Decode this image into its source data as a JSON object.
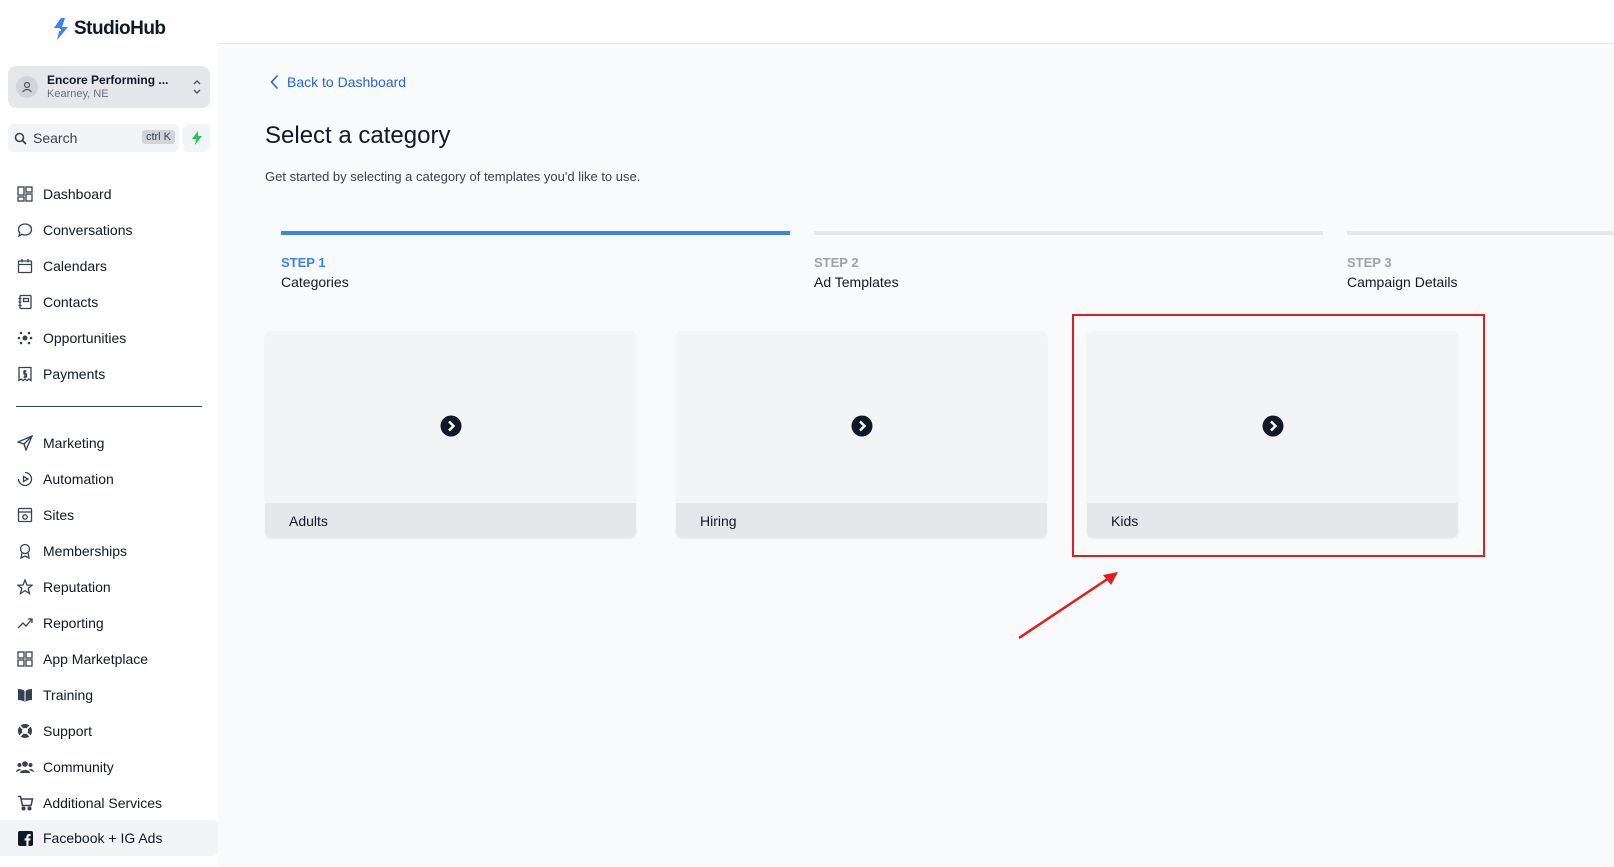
{
  "brand": {
    "name": "StudioHub",
    "accent": "#3b82f6"
  },
  "account": {
    "name": "Encore Performing ...",
    "location": "Kearney, NE"
  },
  "search": {
    "label": "Search",
    "shortcut": "ctrl K"
  },
  "sidebar": {
    "items": [
      {
        "label": "Dashboard",
        "icon": "dashboard-icon"
      },
      {
        "label": "Conversations",
        "icon": "chat-icon"
      },
      {
        "label": "Calendars",
        "icon": "calendar-icon"
      },
      {
        "label": "Contacts",
        "icon": "contacts-icon"
      },
      {
        "label": "Opportunities",
        "icon": "opportunities-icon"
      },
      {
        "label": "Payments",
        "icon": "payments-icon"
      }
    ],
    "items2": [
      {
        "label": "Marketing",
        "icon": "send-icon"
      },
      {
        "label": "Automation",
        "icon": "automation-icon"
      },
      {
        "label": "Sites",
        "icon": "sites-icon"
      },
      {
        "label": "Memberships",
        "icon": "award-icon"
      },
      {
        "label": "Reputation",
        "icon": "star-icon"
      },
      {
        "label": "Reporting",
        "icon": "trend-icon"
      },
      {
        "label": "App Marketplace",
        "icon": "grid-icon"
      },
      {
        "label": "Training",
        "icon": "book-icon"
      },
      {
        "label": "Support",
        "icon": "lifebuoy-icon"
      },
      {
        "label": "Community",
        "icon": "users-icon"
      },
      {
        "label": "Additional Services",
        "icon": "cart-icon"
      },
      {
        "label": "Facebook + IG Ads",
        "icon": "facebook-icon",
        "active": true
      }
    ]
  },
  "main": {
    "back_label": "Back to Dashboard",
    "title": "Select a category",
    "subtitle": "Get started by selecting a category of templates you'd like to use.",
    "steps": [
      {
        "label": "STEP 1",
        "name": "Categories",
        "active": true
      },
      {
        "label": "STEP 2",
        "name": "Ad Templates",
        "active": false
      },
      {
        "label": "STEP 3",
        "name": "Campaign Details",
        "active": false
      }
    ],
    "categories": [
      {
        "label": "Adults"
      },
      {
        "label": "Hiring"
      },
      {
        "label": "Kids"
      }
    ]
  },
  "colors": {
    "active_step": "#3b82f6",
    "inactive_step": "#e5e7eb",
    "annotation": "#e11d1d"
  }
}
